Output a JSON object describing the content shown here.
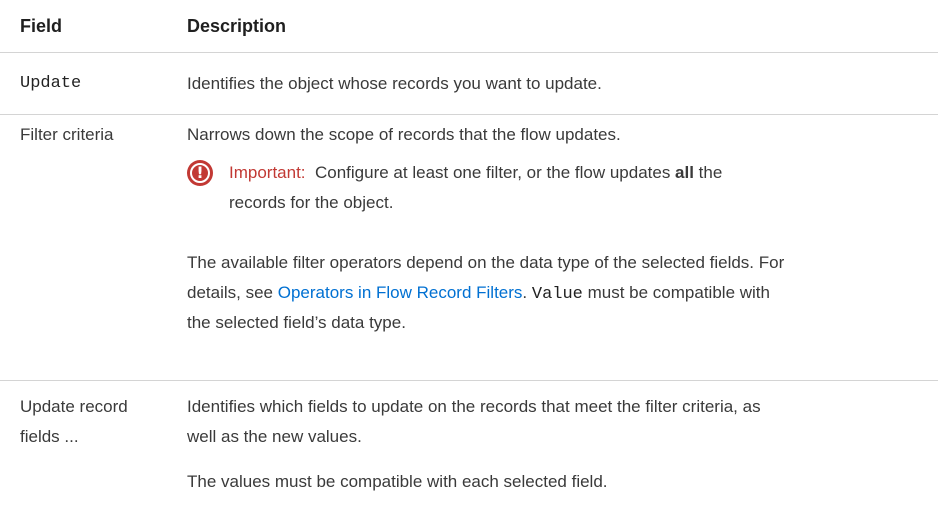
{
  "header": {
    "field": "Field",
    "description": "Description"
  },
  "rows": [
    {
      "field": "Update",
      "description": "Identifies the object whose records you want to update."
    },
    {
      "field": "Filter criteria",
      "description": "Narrows down the scope of records that the flow updates.",
      "important": {
        "label": "Important:",
        "text_before": "Configure at least one filter, or the flow updates ",
        "bold": "all",
        "text_after": " the",
        "line2": "records for the object."
      },
      "note": {
        "line1": "The available filter operators depend on the data type of the selected fields. For",
        "line2_before": "details, see ",
        "link": "Operators in Flow Record Filters",
        "line2_mid": ". ",
        "code": "Value",
        "line2_after": " must be compatible with",
        "line3": "the selected field’s data type."
      }
    },
    {
      "field_line1": "Update record",
      "field_line2": "fields ...",
      "description_line1": "Identifies which fields to update on the records that meet the filter criteria, as",
      "description_line2": "well as the new values.",
      "description_line3": "The values must be compatible with each selected field."
    }
  ],
  "colors": {
    "important": "#c23934",
    "link": "#0070d2"
  },
  "icons": {
    "important": "warning-circle-icon"
  }
}
